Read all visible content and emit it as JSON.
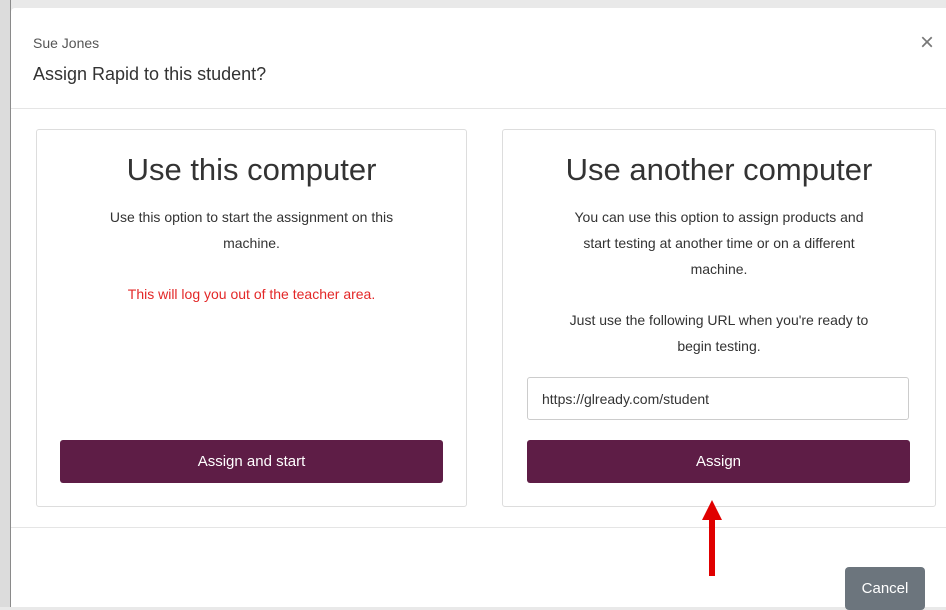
{
  "header": {
    "student_name": "Sue Jones",
    "title": "Assign Rapid to this student?",
    "close_glyph": "×"
  },
  "options": {
    "this_computer": {
      "heading": "Use this computer",
      "description_line1": "Use this option to start the assignment on this",
      "description_line2": "machine.",
      "warning": "This will log you out of the teacher area.",
      "button_label": "Assign and start"
    },
    "another_computer": {
      "heading": "Use another computer",
      "description_line1": "You can use this option to assign products and",
      "description_line2": "start testing at another time or on a different",
      "description_line3": "machine.",
      "url_hint_line1": "Just use the following URL when you're ready to",
      "url_hint_line2": "begin testing.",
      "url_value": "https://glready.com/student",
      "button_label": "Assign"
    }
  },
  "footer": {
    "cancel_label": "Cancel"
  },
  "colors": {
    "primary": "#5e1d46",
    "warning": "#e32828",
    "cancel": "#6c757d",
    "annotation_arrow": "#e00000"
  },
  "icons": {
    "close": "close-icon",
    "arrow": "arrow-up-icon"
  }
}
